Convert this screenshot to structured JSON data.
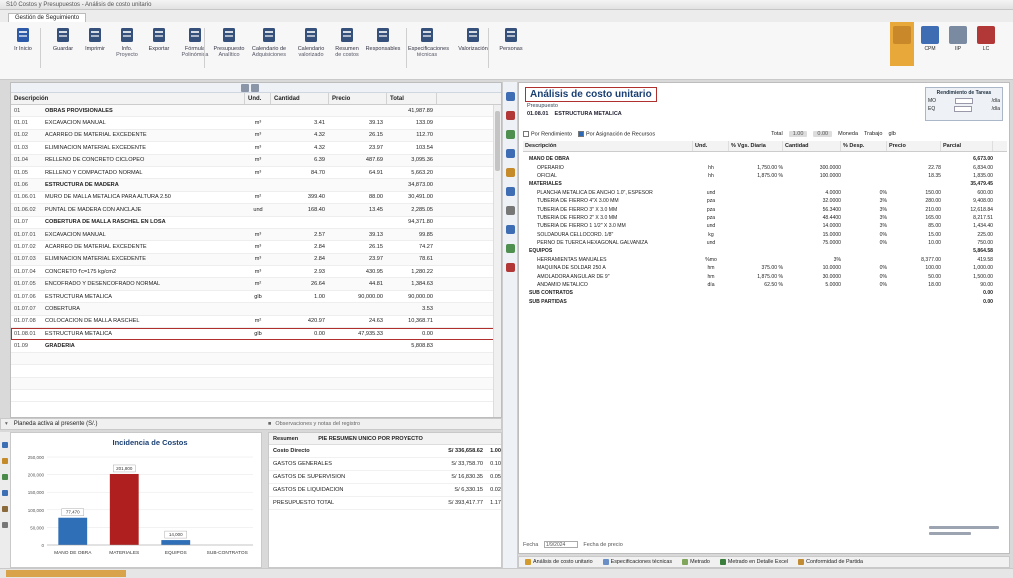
{
  "window": {
    "title": "S10 Costos y Presupuestos - Análisis de costo unitario"
  },
  "tab": {
    "label": "Gestión de Seguimiento"
  },
  "ribbon": {
    "buttons": [
      {
        "label": "Ir Inicio",
        "sub": "",
        "icon": "home-icon",
        "color": "#2d5aa8"
      },
      {
        "label": "Guardar",
        "sub": "",
        "icon": "save-icon",
        "color": "#35507a"
      },
      {
        "label": "Imprimir",
        "sub": "",
        "icon": "print-icon",
        "color": "#35507a"
      },
      {
        "label": "Info.",
        "sub": "Proyecto",
        "icon": "info-icon",
        "color": "#35507a"
      },
      {
        "label": "Exportar",
        "sub": "",
        "icon": "export-icon",
        "color": "#35507a"
      },
      {
        "label": "Fórmula",
        "sub": "Polinómica",
        "icon": "formula-icon",
        "color": "#35507a"
      },
      {
        "label": "Presupuesto",
        "sub": "Analítico",
        "icon": "budget-icon",
        "color": "#35507a"
      },
      {
        "label": "Calendario de",
        "sub": "Adquisiciones",
        "icon": "calendar-icon",
        "color": "#35507a"
      },
      {
        "label": "Calendario",
        "sub": "valorizado",
        "icon": "calendar-valued-icon",
        "color": "#35507a"
      },
      {
        "label": "Resumen",
        "sub": "de costos",
        "icon": "summary-icon",
        "color": "#35507a"
      },
      {
        "label": "Responsables",
        "sub": "",
        "icon": "people-icon",
        "color": "#35507a"
      },
      {
        "label": "Especificaciones",
        "sub": "técnicas",
        "icon": "specs-icon",
        "color": "#35507a"
      },
      {
        "label": "Valorización",
        "sub": "",
        "icon": "valuation-icon",
        "color": "#35507a"
      },
      {
        "label": "Personas",
        "sub": "",
        "icon": "check-person-icon",
        "color": "#35507a"
      }
    ],
    "right_tools": [
      {
        "label": "",
        "icon": "grid-view-icon"
      },
      {
        "label": "CPM",
        "icon": "cpm-icon"
      },
      {
        "label": "IIP",
        "icon": "iip-icon"
      },
      {
        "label": "LC",
        "icon": "lc-icon"
      }
    ]
  },
  "left": {
    "columns": [
      "Descripción",
      "Und.",
      "Cantidad",
      "Precio",
      "Total"
    ],
    "rows": [
      {
        "num": "01",
        "desc": "OBRAS PROVISIONALES",
        "und": "",
        "cant": "",
        "pre": "",
        "tot": "41,987.89",
        "bold": true
      },
      {
        "num": "01.01",
        "desc": "EXCAVACION MANUAL",
        "und": "m³",
        "cant": "3.41",
        "pre": "39.13",
        "tot": "133.09"
      },
      {
        "num": "01.02",
        "desc": "ACARREO DE MATERIAL EXCEDENTE",
        "und": "m³",
        "cant": "4.32",
        "pre": "26.15",
        "tot": "112.70"
      },
      {
        "num": "01.03",
        "desc": "ELIMINACION MATERIAL EXCEDENTE",
        "und": "m³",
        "cant": "4.32",
        "pre": "23.97",
        "tot": "103.54"
      },
      {
        "num": "01.04",
        "desc": "RELLENO DE CONCRETO CICLOPEO",
        "und": "m³",
        "cant": "6.39",
        "pre": "487.69",
        "tot": "3,095.36"
      },
      {
        "num": "01.05",
        "desc": "RELLENO Y COMPACTADO NORMAL",
        "und": "m³",
        "cant": "84.70",
        "pre": "64.91",
        "tot": "5,663.20"
      },
      {
        "num": "01.06",
        "desc": "ESTRUCTURA DE MADERA",
        "und": "",
        "cant": "",
        "pre": "",
        "tot": "34,873.00",
        "bold": true
      },
      {
        "num": "01.06.01",
        "desc": "MURO DE MALLA METALICA PARA ALTURA 2.50",
        "und": "m²",
        "cant": "399.40",
        "pre": "88.00",
        "tot": "30,491.00"
      },
      {
        "num": "01.06.02",
        "desc": "PUNTAL DE MADERA CON ANCLAJE",
        "und": "und",
        "cant": "168.40",
        "pre": "13.45",
        "tot": "2,285.05"
      },
      {
        "num": "01.07",
        "desc": "COBERTURA DE MALLA RASCHEL EN LOSA",
        "und": "",
        "cant": "",
        "pre": "",
        "tot": "94,371.80",
        "bold": true
      },
      {
        "num": "01.07.01",
        "desc": "EXCAVACION MANUAL",
        "und": "m³",
        "cant": "2.57",
        "pre": "39.13",
        "tot": "99.85"
      },
      {
        "num": "01.07.02",
        "desc": "ACARREO DE MATERIAL EXCEDENTE",
        "und": "m³",
        "cant": "2.84",
        "pre": "26.15",
        "tot": "74.27"
      },
      {
        "num": "01.07.03",
        "desc": "ELIMINACION MATERIAL EXCEDENTE",
        "und": "m³",
        "cant": "2.84",
        "pre": "23.97",
        "tot": "78.61"
      },
      {
        "num": "01.07.04",
        "desc": "CONCRETO f'c=175 kg/cm2",
        "und": "m³",
        "cant": "2.93",
        "pre": "430.95",
        "tot": "1,280.22"
      },
      {
        "num": "01.07.05",
        "desc": "ENCOFRADO Y DESENCOFRADO NORMAL",
        "und": "m²",
        "cant": "26.64",
        "pre": "44.81",
        "tot": "1,384.63"
      },
      {
        "num": "01.07.06",
        "desc": "ESTRUCTURA METALICA",
        "und": "glb",
        "cant": "1.00",
        "pre": "90,000.00",
        "tot": "90,000.00"
      },
      {
        "num": "01.07.07",
        "desc": "COBERTURA",
        "und": "",
        "cant": "",
        "pre": "",
        "tot": "3.53"
      },
      {
        "num": "01.07.08",
        "desc": "COLOCACION DE MALLA RASCHEL",
        "und": "m²",
        "cant": "420.97",
        "pre": "24.63",
        "tot": "10,368.71"
      },
      {
        "num": "01.08.01",
        "desc": "ESTRUCTURA METALICA",
        "und": "glb",
        "cant": "0.00",
        "pre": "47,935.33",
        "tot": "0.00",
        "highlight": true
      },
      {
        "num": "01.09",
        "desc": "GRADERIA",
        "und": "",
        "cant": "",
        "pre": "",
        "tot": "5,808.83",
        "bold": true
      },
      {
        "num": "",
        "desc": "",
        "und": "",
        "cant": "",
        "pre": "",
        "tot": ""
      },
      {
        "num": "",
        "desc": "",
        "und": "",
        "cant": "",
        "pre": "",
        "tot": ""
      },
      {
        "num": "",
        "desc": "",
        "und": "",
        "cant": "",
        "pre": "",
        "tot": ""
      },
      {
        "num": "",
        "desc": "",
        "und": "",
        "cant": "",
        "pre": "",
        "tot": ""
      }
    ]
  },
  "bottombar": {
    "filter": "Planeda activa al presente (S/.)",
    "right": "Observaciones y notas del registro"
  },
  "chart_data": {
    "type": "bar",
    "title": "Incidencia de Costos",
    "categories": [
      "MANO DE OBRA",
      "MATERIALES",
      "EQUIPOS",
      "SUB-CONTRATOS"
    ],
    "values": [
      77470,
      201800,
      14000,
      0
    ],
    "data_labels": [
      "77,470",
      "201,800",
      "14,000",
      ""
    ],
    "yticks": [
      "250,000",
      "200,000",
      "150,000",
      "100,000",
      "50,000",
      "0"
    ],
    "ylim": [
      0,
      250000
    ],
    "colors": [
      "#2f6fb7",
      "#b01f1f",
      "#2f6fb7",
      "#2f6fb7"
    ]
  },
  "summary": {
    "header": [
      "Resumen",
      "PIE RESUMEN UNICO POR PROYECTO"
    ],
    "rows": [
      {
        "k": "Costo Directo",
        "v": "S/ 336,658.62",
        "p": "1.00",
        "bold": true
      },
      {
        "k": "GASTOS GENERALES",
        "v": "S/ 33,758.70",
        "p": "0.10"
      },
      {
        "k": "GASTOS DE SUPERVISION",
        "v": "S/ 16,830.35",
        "p": "0.05"
      },
      {
        "k": "GASTOS DE LIQUIDACION",
        "v": "S/ 6,330.15",
        "p": "0.02"
      },
      {
        "k": "PRESUPUESTO TOTAL",
        "v": "S/ 393,417.77",
        "p": "1.17"
      }
    ]
  },
  "right": {
    "title": "Análisis de costo unitario",
    "presupuesto_label": "Presupuesto",
    "item_code": "01.08.01",
    "item_name": "ESTRUCTURA METALICA",
    "rendimiento": {
      "title": "Rendimiento de Tareas",
      "mo": "MO",
      "eq": "EQ",
      "day": "/día",
      "mo_value": "",
      "eq_value": ""
    },
    "toolbar": {
      "by_rend": "Por Rendimiento",
      "by_resource": "Por Asignación de Recursos",
      "total": "Total",
      "p1": "1.00",
      "p2": "0.00",
      "moneda": "Moneda",
      "trabajo": "Trabajo",
      "glb": "glb"
    },
    "columns": [
      "Descripción",
      "Und.",
      "% Vgs. Diaria",
      "Cantidad",
      "% Desp.",
      "Precio",
      "Parcial"
    ],
    "rows": [
      {
        "type": "sec",
        "d": "MANO DE OBRA",
        "u": "",
        "vd": "",
        "ca": "",
        "pj": "",
        "pr": "",
        "pt": "6,673.00"
      },
      {
        "type": "item",
        "d": "OPERARIO",
        "u": "hh",
        "vd": "1,750.00 %",
        "ca": "300.0000",
        "pj": "",
        "pr": "22.78",
        "pt": "6,834.00"
      },
      {
        "type": "item",
        "d": "OFICIAL",
        "u": "hh",
        "vd": "1,875.00 %",
        "ca": "100.0000",
        "pj": "",
        "pr": "18.35",
        "pt": "1,835.00"
      },
      {
        "type": "sec",
        "d": "MATERIALES",
        "u": "",
        "vd": "",
        "ca": "",
        "pj": "",
        "pr": "",
        "pt": "35,479.45"
      },
      {
        "type": "item",
        "d": "PLANCHA METALICA DE ANCHO 1.0\", ESPESOR",
        "u": "und",
        "vd": "",
        "ca": "4.0000",
        "pj": "0%",
        "pr": "150.00",
        "pt": "600.00"
      },
      {
        "type": "item",
        "d": "TUBERIA DE FIERRO 4\"X 3.00 MM",
        "u": "pza",
        "vd": "",
        "ca": "32.0000",
        "pj": "3%",
        "pr": "280.00",
        "pt": "9,408.00"
      },
      {
        "type": "item",
        "d": "TUBERIA DE FIERRO 3\" X 3.0 MM",
        "u": "pza",
        "vd": "",
        "ca": "56.3400",
        "pj": "3%",
        "pr": "210.00",
        "pt": "12,618.84"
      },
      {
        "type": "item",
        "d": "TUBERIA DE FIERRO 2\" X 3.0 MM",
        "u": "pza",
        "vd": "",
        "ca": "48.4400",
        "pj": "3%",
        "pr": "165.00",
        "pt": "8,217.51"
      },
      {
        "type": "item",
        "d": "TUBERIA DE FIERRO 1 1/2\" X 3.0 MM",
        "u": "und",
        "vd": "",
        "ca": "14.0000",
        "pj": "3%",
        "pr": "85.00",
        "pt": "1,434.40"
      },
      {
        "type": "item",
        "d": "SOLDADURA CELLOCORD. 1/8\"",
        "u": "kg",
        "vd": "",
        "ca": "15.0000",
        "pj": "0%",
        "pr": "15.00",
        "pt": "225.00"
      },
      {
        "type": "item",
        "d": "PERNO DE TUERCA HEXAGONAL GALVANIZA",
        "u": "und",
        "vd": "",
        "ca": "75.0000",
        "pj": "0%",
        "pr": "10.00",
        "pt": "750.00"
      },
      {
        "type": "sec",
        "d": "EQUIPOS",
        "u": "",
        "vd": "",
        "ca": "",
        "pj": "",
        "pr": "",
        "pt": "5,864.58"
      },
      {
        "type": "item",
        "d": "HERRAMIENTAS MANUALES",
        "u": "%mo",
        "vd": "",
        "ca": "3%",
        "pj": "",
        "pr": "8,377.00",
        "pt": "419.58"
      },
      {
        "type": "item",
        "d": "MAQUINA DE SOLDAR 250 A",
        "u": "hm",
        "vd": "375.00 %",
        "ca": "10.0000",
        "pj": "0%",
        "pr": "100.00",
        "pt": "1,000.00"
      },
      {
        "type": "item",
        "d": "AMOLADORA ANGULAR DE 9\"",
        "u": "hm",
        "vd": "1,875.00 %",
        "ca": "30.0000",
        "pj": "0%",
        "pr": "50.00",
        "pt": "1,500.00"
      },
      {
        "type": "item",
        "d": "ANDAMIO METALICO",
        "u": "día",
        "vd": "62.50 %",
        "ca": "5.0000",
        "pj": "0%",
        "pr": "18.00",
        "pt": "90.00"
      },
      {
        "type": "sec",
        "d": "SUB CONTRATOS",
        "u": "",
        "vd": "",
        "ca": "",
        "pj": "",
        "pr": "",
        "pt": "0.00"
      },
      {
        "type": "sec",
        "d": "SUB PARTIDAS",
        "u": "",
        "vd": "",
        "ca": "",
        "pj": "",
        "pr": "",
        "pt": "0.00"
      }
    ],
    "footer": {
      "fecha_label": "Fecha",
      "fecha": "1/9/2024",
      "fecha_precio": "Fecha de precio"
    }
  },
  "right_tabs": [
    {
      "label": "Análisis de costo unitario",
      "color": "#d39a2c"
    },
    {
      "label": "Especificaciones técnicas",
      "color": "#6a8fc7"
    },
    {
      "label": "Metrado",
      "color": "#7fa65b"
    },
    {
      "label": "Metrado en Detalle Excel",
      "color": "#3b7d3b"
    },
    {
      "label": "Conformidad de Partida",
      "color": "#c08b32"
    }
  ]
}
